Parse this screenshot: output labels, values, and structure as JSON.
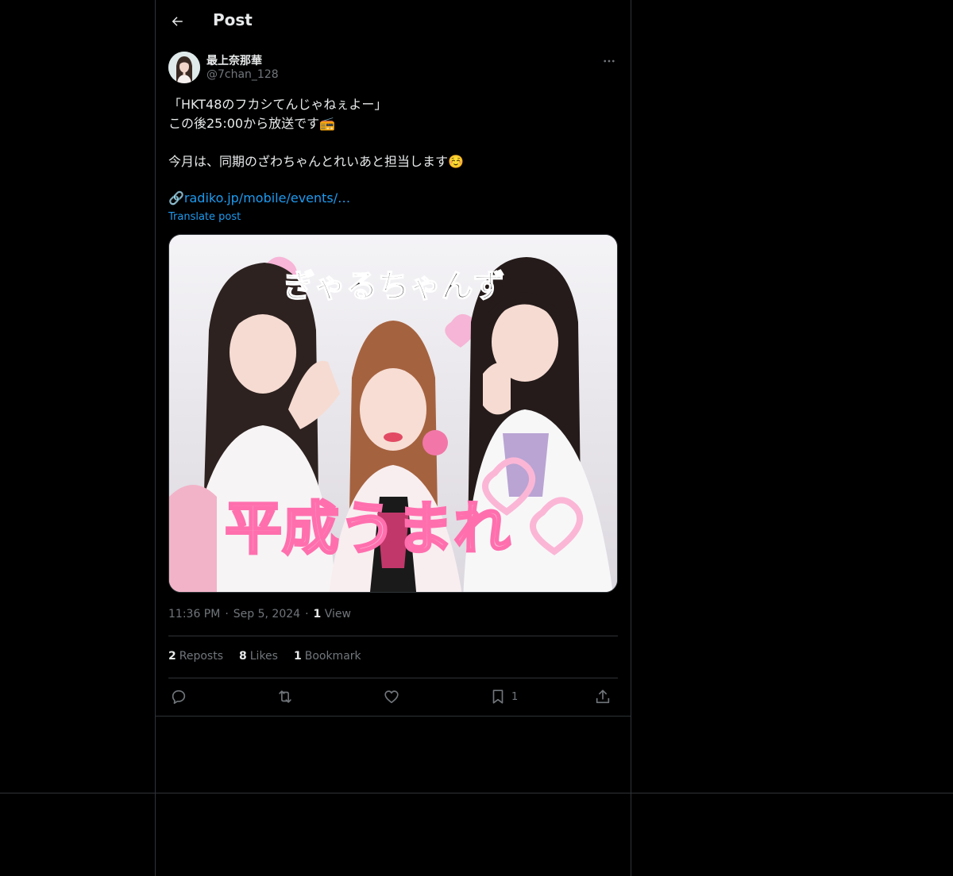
{
  "header": {
    "title": "Post"
  },
  "author": {
    "name": "最上奈那華",
    "handle": "@7chan_128"
  },
  "post": {
    "text": "「HKT48のフカシてんじゃねぇよー」\nこの後25:00から放送です📻\n\n今月は、同期のざわちゃんとれいあと担当します☺️",
    "link_emoji": "🔗",
    "link_text": "radiko.jp/mobile/events/…",
    "translate": "Translate post"
  },
  "media": {
    "title_text": "ぎゃるちゃんず",
    "caption_text": "平成うまれ"
  },
  "meta": {
    "time": "11:36 PM",
    "date": "Sep 5, 2024",
    "views_count": "1",
    "views_label": "View"
  },
  "stats": {
    "reposts_count": "2",
    "reposts_label": "Reposts",
    "likes_count": "8",
    "likes_label": "Likes",
    "bookmarks_count": "1",
    "bookmarks_label": "Bookmark"
  },
  "actions": {
    "bookmark_count": "1"
  },
  "colors": {
    "accent": "#1d9bf0",
    "muted": "#71767b",
    "text": "#e7e9ea",
    "border": "#2f3336",
    "background": "#000000"
  },
  "icons": [
    "back-arrow-icon",
    "more-icon",
    "reply-icon",
    "repost-icon",
    "like-icon",
    "bookmark-icon",
    "share-icon"
  ]
}
